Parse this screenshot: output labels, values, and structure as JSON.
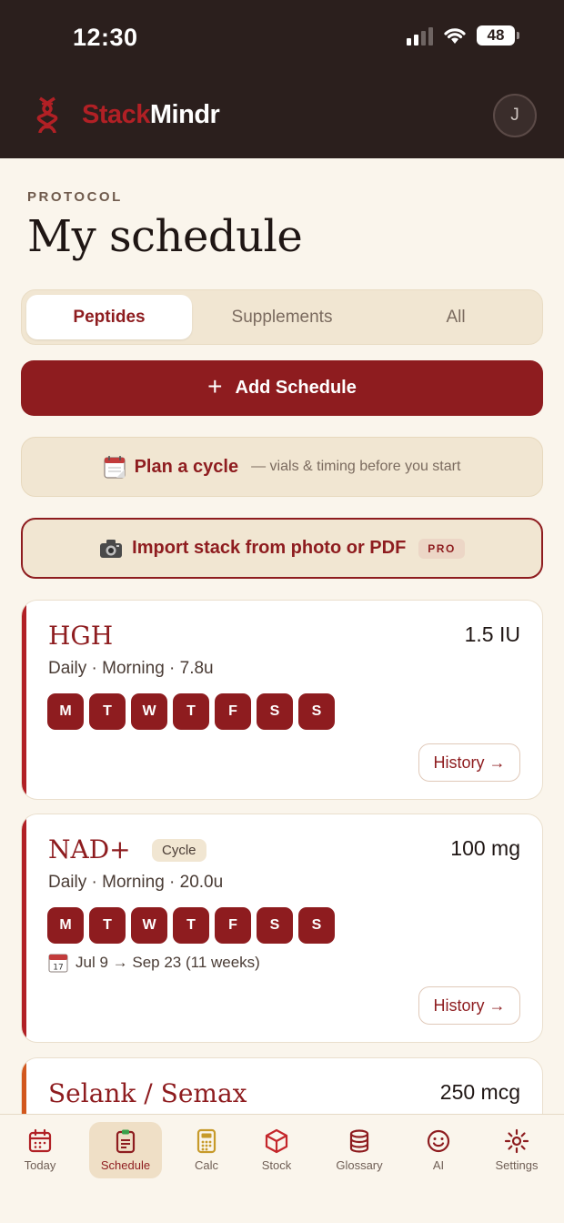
{
  "status": {
    "time": "12:30",
    "battery": "48"
  },
  "header": {
    "brand_part1": "Stack",
    "brand_part2": "Mindr",
    "avatar_initial": "J"
  },
  "page": {
    "eyebrow": "PROTOCOL",
    "title": "My schedule"
  },
  "tabs": [
    {
      "label": "Peptides",
      "active": true
    },
    {
      "label": "Supplements",
      "active": false
    },
    {
      "label": "All",
      "active": false
    }
  ],
  "actions": {
    "add_schedule": "Add Schedule",
    "plan_label": "Plan a cycle",
    "plan_sub": "— vials & timing before you start",
    "import_label": "Import stack from photo or PDF",
    "import_badge": "PRO"
  },
  "cards": [
    {
      "name": "HGH",
      "dose": "1.5 IU",
      "meta": "Daily · Morning · 7.8u",
      "days": [
        "M",
        "T",
        "W",
        "T",
        "F",
        "S",
        "S"
      ],
      "history": "History →",
      "accent": "#b12025"
    },
    {
      "name": "NAD+",
      "badge": "Cycle",
      "dose": "100 mg",
      "meta": "Daily · Morning · 20.0u",
      "days": [
        "M",
        "T",
        "W",
        "T",
        "F",
        "S",
        "S"
      ],
      "range": "Jul 9 → Sep 23 (11 weeks)",
      "history": "History →",
      "accent": "#b12025"
    },
    {
      "name": "Selank / Semax",
      "dose": "250 mcg",
      "accent": "#d2571d"
    }
  ],
  "nav": [
    {
      "label": "Today",
      "icon": "calendar-icon",
      "active": false,
      "color": "#b12025"
    },
    {
      "label": "Schedule",
      "icon": "clipboard-icon",
      "active": true,
      "color": "#8e1c1f"
    },
    {
      "label": "Calc",
      "icon": "calculator-icon",
      "active": false,
      "color": "#c79a2a"
    },
    {
      "label": "Stock",
      "icon": "box-icon",
      "active": false,
      "color": "#c4262b"
    },
    {
      "label": "Glossary",
      "icon": "database-icon",
      "active": false,
      "color": "#8e1c1f"
    },
    {
      "label": "AI",
      "icon": "smile-icon",
      "active": false,
      "color": "#8e1c1f"
    },
    {
      "label": "Settings",
      "icon": "gear-icon",
      "active": false,
      "color": "#8e1c1f"
    }
  ]
}
